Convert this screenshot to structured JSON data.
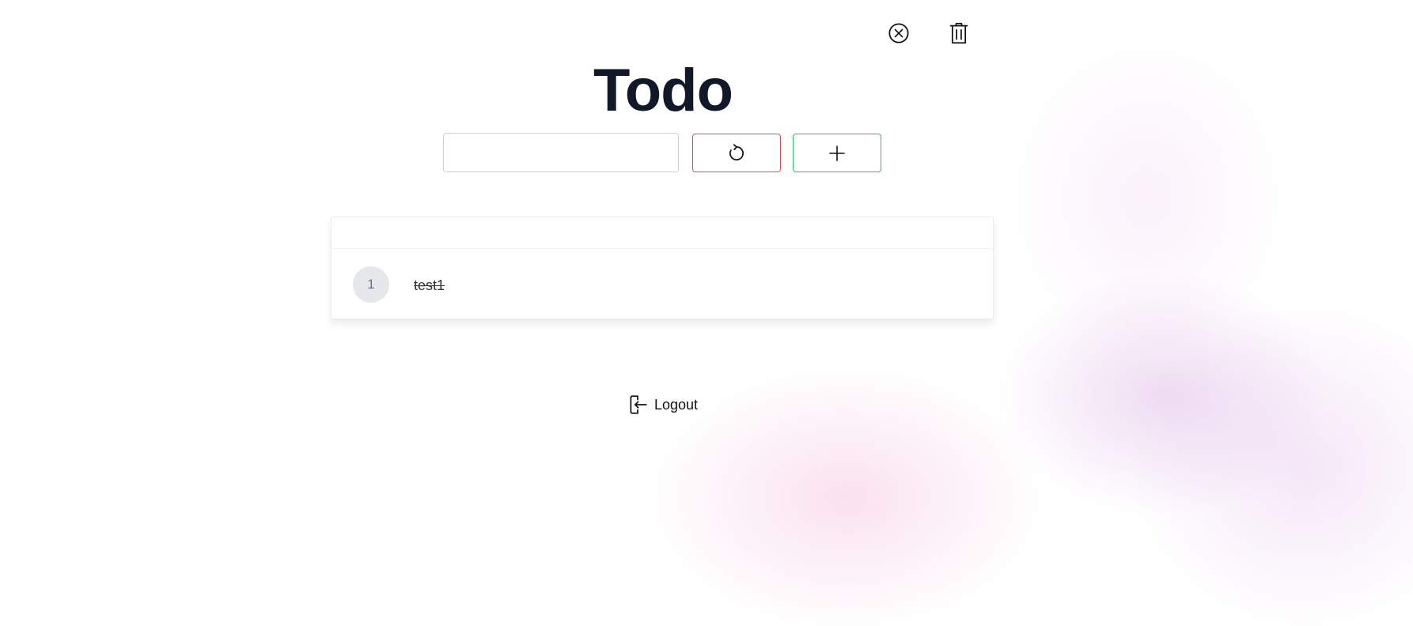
{
  "app": {
    "title": "Todo"
  },
  "form": {
    "input_value": "",
    "input_placeholder": "",
    "reset_icon": "refresh-icon",
    "add_icon": "plus-icon",
    "reset_color": "#ef4444",
    "add_color": "#22c55e"
  },
  "todos": [
    {
      "index": "1",
      "text": "test1",
      "completed": true,
      "actions": [
        "uncheck-circle-x-icon",
        "trash-icon"
      ]
    }
  ],
  "logout": {
    "label": "Logout",
    "icon": "logout-icon"
  }
}
